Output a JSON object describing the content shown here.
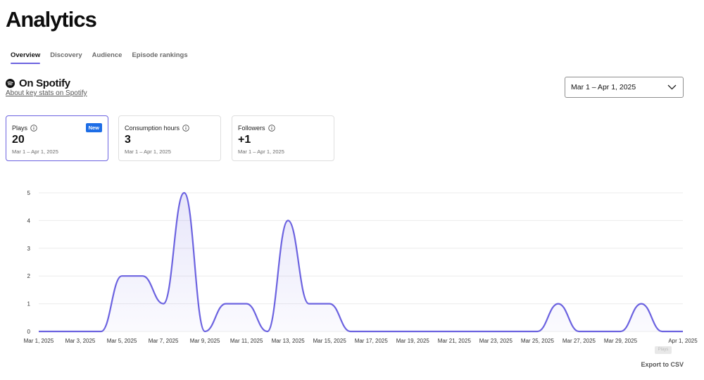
{
  "page": {
    "title": "Analytics"
  },
  "tabs": [
    {
      "label": "Overview",
      "active": true
    },
    {
      "label": "Discovery",
      "active": false
    },
    {
      "label": "Audience",
      "active": false
    },
    {
      "label": "Episode rankings",
      "active": false
    }
  ],
  "section": {
    "title": "On Spotify",
    "about_link": "About key stats on Spotify"
  },
  "date_filter": {
    "selected": "Mar 1 – Apr 1, 2025"
  },
  "cards": [
    {
      "label": "Plays",
      "value": "20",
      "range": "Mar 1 – Apr 1, 2025",
      "badge": "New"
    },
    {
      "label": "Consumption hours",
      "value": "3",
      "range": "Mar 1 – Apr 1, 2025"
    },
    {
      "label": "Followers",
      "value": "+1",
      "range": "Mar 1 – Apr 1, 2025"
    }
  ],
  "export": {
    "label": "Export to CSV",
    "tooltip": "Plays"
  },
  "colors": {
    "accent": "#6c63e0",
    "badge": "#1d6de6"
  },
  "chart_data": {
    "type": "area",
    "ylim": [
      0,
      5
    ],
    "yticks": [
      0,
      1,
      2,
      3,
      4,
      5
    ],
    "x_tick_labels": [
      "Mar 1, 2025",
      "Mar 3, 2025",
      "Mar 5, 2025",
      "Mar 7, 2025",
      "Mar 9, 2025",
      "Mar 11, 2025",
      "Mar 13, 2025",
      "Mar 15, 2025",
      "Mar 17, 2025",
      "Mar 19, 2025",
      "Mar 21, 2025",
      "Mar 23, 2025",
      "Mar 25, 2025",
      "Mar 27, 2025",
      "Mar 29, 2025",
      "Apr 1, 2025"
    ],
    "x": [
      "Mar 1, 2025",
      "Mar 2, 2025",
      "Mar 3, 2025",
      "Mar 4, 2025",
      "Mar 5, 2025",
      "Mar 6, 2025",
      "Mar 7, 2025",
      "Mar 8, 2025",
      "Mar 9, 2025",
      "Mar 10, 2025",
      "Mar 11, 2025",
      "Mar 12, 2025",
      "Mar 13, 2025",
      "Mar 14, 2025",
      "Mar 15, 2025",
      "Mar 16, 2025",
      "Mar 17, 2025",
      "Mar 18, 2025",
      "Mar 19, 2025",
      "Mar 20, 2025",
      "Mar 21, 2025",
      "Mar 22, 2025",
      "Mar 23, 2025",
      "Mar 24, 2025",
      "Mar 25, 2025",
      "Mar 26, 2025",
      "Mar 27, 2025",
      "Mar 28, 2025",
      "Mar 29, 2025",
      "Mar 30, 2025",
      "Mar 31, 2025",
      "Apr 1, 2025"
    ],
    "series": [
      {
        "values": [
          0,
          0,
          0,
          0,
          2,
          2,
          1,
          5,
          0,
          1,
          1,
          0,
          4,
          1,
          1,
          0,
          0,
          0,
          0,
          0,
          0,
          0,
          0,
          0,
          0,
          1,
          0,
          0,
          0,
          1,
          0,
          0
        ]
      }
    ],
    "grid": true
  }
}
